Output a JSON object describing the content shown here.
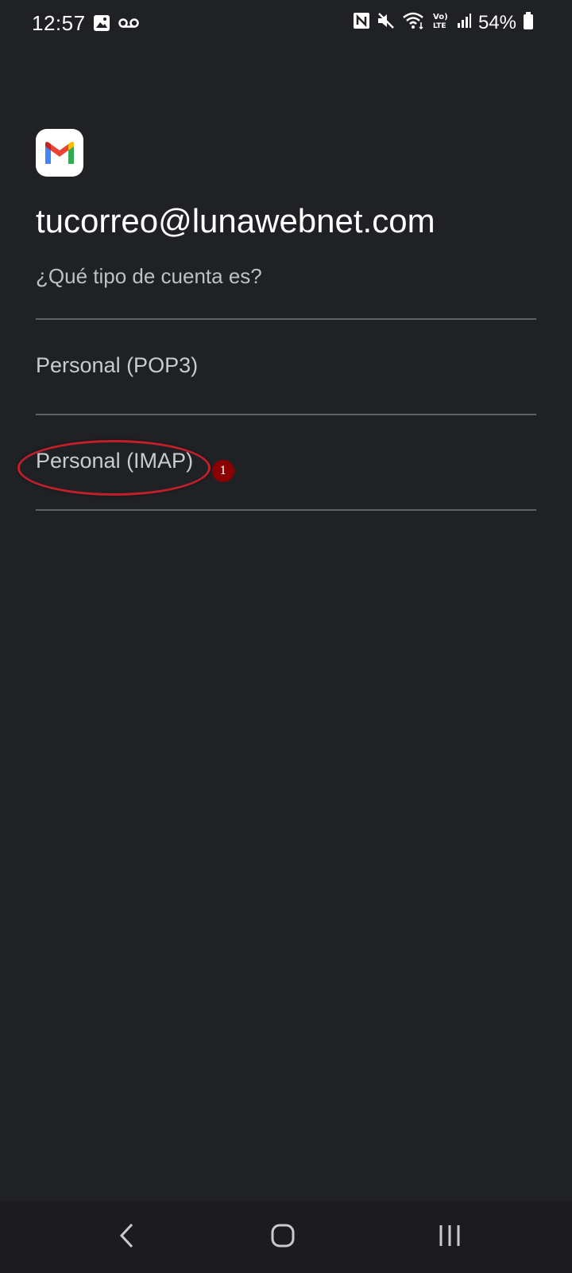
{
  "status_bar": {
    "time": "12:57",
    "battery": "54%",
    "left_icons": [
      "gallery-icon",
      "voicemail-icon"
    ],
    "right_icons": [
      "nfc-icon",
      "mute-icon",
      "wifi-icon",
      "volte-icon",
      "signal-icon",
      "battery-icon"
    ]
  },
  "header": {
    "logo": "gmail-icon",
    "email": "tucorreo@lunawebnet.com",
    "question": "¿Qué tipo de cuenta es?"
  },
  "options": [
    {
      "label": "Personal (POP3)"
    },
    {
      "label": "Personal (IMAP)"
    }
  ],
  "annotation": {
    "badge": "1",
    "color": "#c0202a"
  },
  "nav_bar": {
    "buttons": [
      "back-icon",
      "home-icon",
      "recents-icon"
    ]
  }
}
